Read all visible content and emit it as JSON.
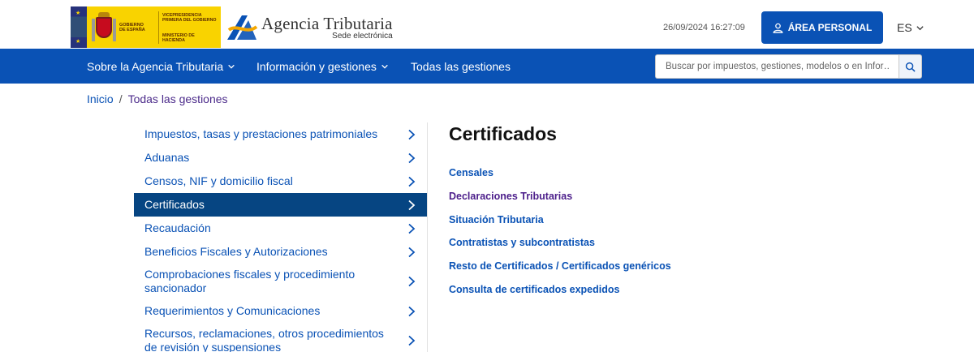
{
  "header": {
    "gov_logo_lines": [
      "GOBIERNO",
      "DE ESPAÑA"
    ],
    "gov_logo_vice": "VICEPRESIDENCIA PRIMERA DEL GOBIERNO",
    "gov_logo_ministry": "MINISTERIO DE HACIENDA",
    "agency_title": "Agencia Tributaria",
    "agency_subtitle": "Sede electrónica",
    "datetime": "26/09/2024 16:27:09",
    "area_personal_label": "ÁREA PERSONAL",
    "language": "ES"
  },
  "nav": {
    "items": [
      {
        "label": "Sobre la Agencia Tributaria",
        "has_dropdown": true
      },
      {
        "label": "Información y gestiones",
        "has_dropdown": true
      },
      {
        "label": "Todas las gestiones",
        "has_dropdown": false
      }
    ],
    "search_placeholder": "Buscar por impuestos, gestiones, modelos o en Infor…"
  },
  "breadcrumb": {
    "home": "Inicio",
    "separator": "/",
    "current": "Todas las gestiones"
  },
  "sidebar": {
    "items": [
      {
        "label": "Impuestos, tasas y prestaciones patrimoniales"
      },
      {
        "label": "Aduanas"
      },
      {
        "label": "Censos, NIF y domicilio fiscal"
      },
      {
        "label": "Certificados",
        "active": true
      },
      {
        "label": "Recaudación"
      },
      {
        "label": "Beneficios Fiscales y Autorizaciones"
      },
      {
        "label": "Comprobaciones fiscales y procedimiento sancionador"
      },
      {
        "label": "Requerimientos y Comunicaciones"
      },
      {
        "label": "Recursos, reclamaciones, otros procedimientos de revisión y suspensiones"
      }
    ]
  },
  "content": {
    "title": "Certificados",
    "links": [
      {
        "label": "Censales"
      },
      {
        "label": "Declaraciones Tributarias",
        "visited": true
      },
      {
        "label": "Situación Tributaria"
      },
      {
        "label": "Contratistas y subcontratistas"
      },
      {
        "label": "Resto de Certificados / Certificados genéricos"
      },
      {
        "label": "Consulta de certificados expedidos"
      }
    ]
  },
  "colors": {
    "primary_blue": "#0a52b5",
    "active_item_bg": "#064582",
    "visited_link": "#4b1d8a",
    "gov_yellow": "#f9d300"
  }
}
